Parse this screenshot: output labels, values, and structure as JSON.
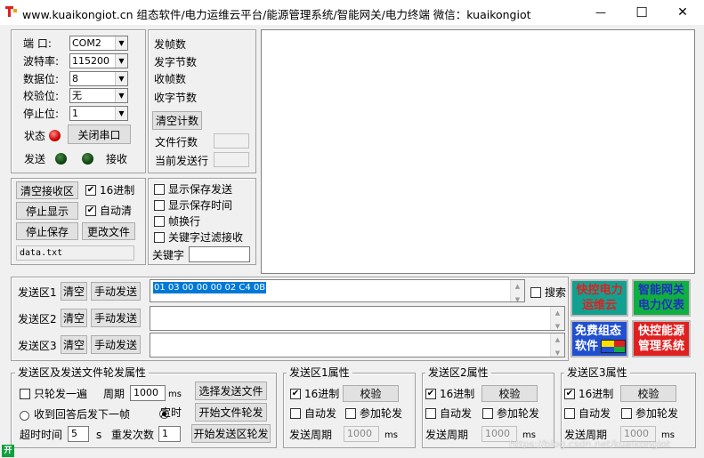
{
  "window": {
    "title": "www.kuaikongiot.cn    组态软件/电力运维云平台/能源管理系统/智能网关/电力终端    微信：kuaikongiot",
    "minimize": "—",
    "maximize": "☐",
    "close": "✕"
  },
  "port": {
    "port_label": "端  口:",
    "port_value": "COM2",
    "baud_label": "波特率:",
    "baud_value": "115200",
    "databits_label": "数据位:",
    "databits_value": "8",
    "parity_label": "校验位:",
    "parity_value": "无",
    "stopbits_label": "停止位:",
    "stopbits_value": "1",
    "status_label": "状态",
    "close_port_button": "关闭串口",
    "send_label": "发送",
    "recv_label": "接收"
  },
  "stats": {
    "sent_frames": "发帧数",
    "sent_bytes": "发字节数",
    "recv_frames": "收帧数",
    "recv_bytes": "收字节数",
    "clear_counts": "清空计数",
    "file_lines": "文件行数",
    "current_line": "当前发送行"
  },
  "recv_opts": {
    "clear_recv": "清空接收区",
    "hex_label": "16进制",
    "hex_checked": "✔",
    "stop_display": "停止显示",
    "auto_clear": "自动清",
    "auto_clear_checked": "✔",
    "stop_save": "停止保存",
    "change_file": "更改文件",
    "filename": "data.txt"
  },
  "display_opts": {
    "show_save_send": "显示保存发送",
    "show_save_time": "显示保存时间",
    "frame_newline": "帧换行",
    "keyword_filter": "关键字过滤接收",
    "keyword_label": "关键字"
  },
  "send_areas": [
    {
      "label": "发送区1",
      "clear": "清空",
      "manual": "手动发送",
      "content": "01 03 00 00 00 02 C4 0B"
    },
    {
      "label": "发送区2",
      "clear": "清空",
      "manual": "手动发送",
      "content": ""
    },
    {
      "label": "发送区3",
      "clear": "清空",
      "manual": "手动发送",
      "content": ""
    }
  ],
  "search_label": "搜索",
  "ads": {
    "a1": "快控电力运维云",
    "a2": "智能网关电力仪表",
    "a3": "免费组态软件",
    "a4": "快控能源管理系统",
    "colors": {
      "red": "#e02020",
      "green": "#10b040",
      "teal": "#12a090",
      "blue": "#2050d0"
    }
  },
  "poll_group": {
    "title": "发送区及发送文件轮发属性",
    "only_once": "只轮发一遍",
    "period_label": "周期",
    "period_value": "1000",
    "ms": "ms",
    "select_file": "选择发送文件",
    "recv_next": "收到回答后发下一帧",
    "timed": "定时",
    "start_file_poll": "开始文件轮发",
    "timeout_label": "超时时间",
    "timeout_value": "5",
    "s": "s",
    "retry_label": "重发次数",
    "retry_value": "1",
    "start_area_poll": "开始发送区轮发"
  },
  "area_props": [
    {
      "title": "发送区1属性",
      "hex": "16进制",
      "checksum": "校验",
      "auto_send": "自动发",
      "join_poll": "参加轮发",
      "period_label": "发送周期",
      "period_value": "1000",
      "ms": "ms"
    },
    {
      "title": "发送区2属性",
      "hex": "16进制",
      "checksum": "校验",
      "auto_send": "自动发",
      "join_poll": "参加轮发",
      "period_label": "发送周期",
      "period_value": "1000",
      "ms": "ms"
    },
    {
      "title": "发送区3属性",
      "hex": "16进制",
      "checksum": "校验",
      "auto_send": "自动发",
      "join_poll": "参加轮发",
      "period_label": "发送周期",
      "period_value": "1000",
      "ms": "ms"
    }
  ],
  "watermark": "https://blog.csdn.net/kuaikongiot",
  "status_icon": "开"
}
